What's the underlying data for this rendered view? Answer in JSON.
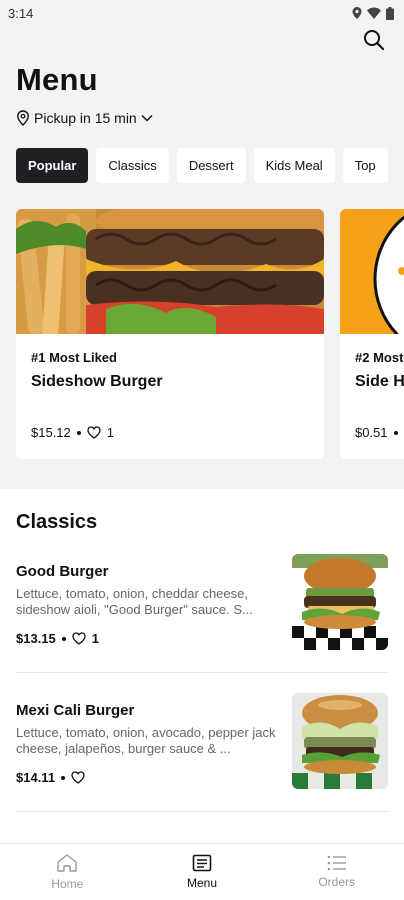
{
  "status_bar": {
    "time": "3:14"
  },
  "header": {
    "title": "Menu",
    "pickup": "Pickup in 15 min"
  },
  "categories": [
    {
      "label": "Popular",
      "active": true
    },
    {
      "label": "Classics",
      "active": false
    },
    {
      "label": "Dessert",
      "active": false
    },
    {
      "label": "Kids Meal",
      "active": false
    },
    {
      "label": "Top",
      "active": false
    }
  ],
  "featured": [
    {
      "rank": "#1 Most Liked",
      "name": "Sideshow Burger",
      "price": "$15.12",
      "likes": "1"
    },
    {
      "rank": "#2 Most",
      "name": "Side H",
      "price": "$0.51",
      "likes": ""
    }
  ],
  "classics": {
    "title": "Classics",
    "items": [
      {
        "name": "Good Burger",
        "description": "Lettuce, tomato, onion, cheddar cheese, sideshow aioli, \"Good Burger\" sauce. S...",
        "price": "$13.15",
        "likes": "1"
      },
      {
        "name": "Mexi Cali Burger",
        "description": "Lettuce, tomato, onion, avocado, pepper jack cheese, jalapeños, burger sauce & ...",
        "price": "$14.11",
        "likes": ""
      }
    ]
  },
  "bottom_nav": [
    {
      "label": "Home",
      "icon": "home-icon",
      "active": false
    },
    {
      "label": "Menu",
      "icon": "menu-book-icon",
      "active": true
    },
    {
      "label": "Orders",
      "icon": "list-icon",
      "active": false
    }
  ],
  "colors": {
    "active_chip": "#1f1f24",
    "card_bg": "#ffffff",
    "page_bg": "#f3f3f4",
    "accent_orange": "#f5a21a"
  }
}
